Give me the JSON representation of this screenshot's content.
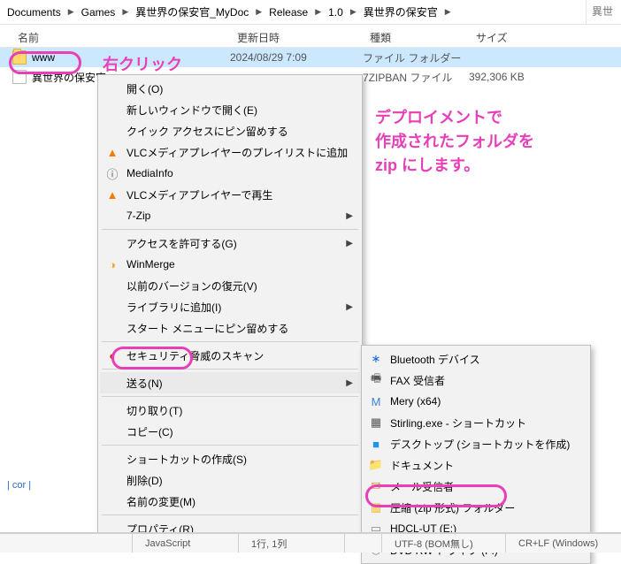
{
  "breadcrumb": [
    "Documents",
    "Games",
    "異世界の保安官_MyDoc",
    "Release",
    "1.0",
    "異世界の保安官"
  ],
  "search_placeholder": "異世",
  "columns": {
    "name": "名前",
    "date": "更新日時",
    "type": "種類",
    "size": "サイズ"
  },
  "rows": [
    {
      "name": "www",
      "date": "2024/08/29 7:09",
      "type": "ファイル フォルダー",
      "size": ""
    },
    {
      "name": "異世界の保安官",
      "date": "",
      "type": "7ZIPBAN ファイル",
      "size": "392,306 KB"
    }
  ],
  "annotations": {
    "right_click": "右クリック",
    "deploy_note": "デプロイメントで\n作成されたフォルダを\nzip にします。"
  },
  "context_menu": [
    {
      "label": "開く(O)"
    },
    {
      "label": "新しいウィンドウで開く(E)"
    },
    {
      "label": "クイック アクセスにピン留めする"
    },
    {
      "label": "VLCメディアプレイヤーのプレイリストに追加",
      "icon": "vlc-icon",
      "iclass": "ic-vlc",
      "glyph": "▲"
    },
    {
      "label": "MediaInfo",
      "icon": "mediainfo-icon",
      "iclass": "ic-media",
      "glyph": "ⓘ"
    },
    {
      "label": "VLCメディアプレイヤーで再生",
      "icon": "vlc-icon",
      "iclass": "ic-vlc",
      "glyph": "▲"
    },
    {
      "label": "7-Zip",
      "submenu": true
    },
    {
      "sep": true
    },
    {
      "label": "アクセスを許可する(G)",
      "submenu": true
    },
    {
      "label": "WinMerge",
      "icon": "winmerge-icon",
      "iclass": "ic-winmerge",
      "glyph": "◑"
    },
    {
      "label": "以前のバージョンの復元(V)"
    },
    {
      "label": "ライブラリに追加(I)",
      "submenu": true
    },
    {
      "label": "スタート メニューにピン留めする"
    },
    {
      "sep": true
    },
    {
      "label": "セキュリティ脅威のスキャン",
      "icon": "trend-icon",
      "iclass": "ic-trend",
      "glyph": "◐"
    },
    {
      "sep": true
    },
    {
      "label": "送る(N)",
      "submenu": true,
      "highlighted": true
    },
    {
      "sep": true
    },
    {
      "label": "切り取り(T)"
    },
    {
      "label": "コピー(C)"
    },
    {
      "sep": true
    },
    {
      "label": "ショートカットの作成(S)"
    },
    {
      "label": "削除(D)"
    },
    {
      "label": "名前の変更(M)"
    },
    {
      "sep": true
    },
    {
      "label": "プロパティ(R)"
    }
  ],
  "send_to_menu": [
    {
      "label": "Bluetooth デバイス",
      "icon": "bluetooth-icon",
      "iclass": "ic-bt",
      "glyph": "∗"
    },
    {
      "label": "FAX 受信者",
      "icon": "fax-icon",
      "iclass": "ic-fax",
      "glyph": "🖷"
    },
    {
      "label": "Mery (x64)",
      "icon": "mery-icon",
      "iclass": "ic-mery",
      "glyph": "M"
    },
    {
      "label": "Stirling.exe - ショートカット",
      "icon": "stirling-icon",
      "iclass": "ic-stir",
      "glyph": "▦"
    },
    {
      "label": "デスクトップ (ショートカットを作成)",
      "icon": "desktop-icon",
      "iclass": "ic-desk",
      "glyph": "■"
    },
    {
      "label": "ドキュメント",
      "icon": "documents-icon",
      "iclass": "ic-doc",
      "glyph": "📁"
    },
    {
      "label": "メール受信者",
      "icon": "mail-icon",
      "iclass": "ic-mail",
      "glyph": "✉"
    },
    {
      "label": "圧縮 (zip 形式) フォルダー",
      "icon": "zip-folder-icon",
      "iclass": "ic-zip",
      "glyph": "▥",
      "ring": true
    },
    {
      "label": "HDCL-UT (E:)",
      "icon": "drive-icon",
      "iclass": "ic-drive",
      "glyph": "▭"
    },
    {
      "label": "DVD RW ドライブ (F:)",
      "icon": "cd-drive-icon",
      "iclass": "ic-cd",
      "glyph": "◎"
    }
  ],
  "footer_left_partial": "| cor |",
  "statusbar": {
    "lang": "JavaScript",
    "pos": "1行, 1列",
    "enc1": "UTF-8 (BOM無し)",
    "enc2": "CR+LF (Windows)"
  }
}
